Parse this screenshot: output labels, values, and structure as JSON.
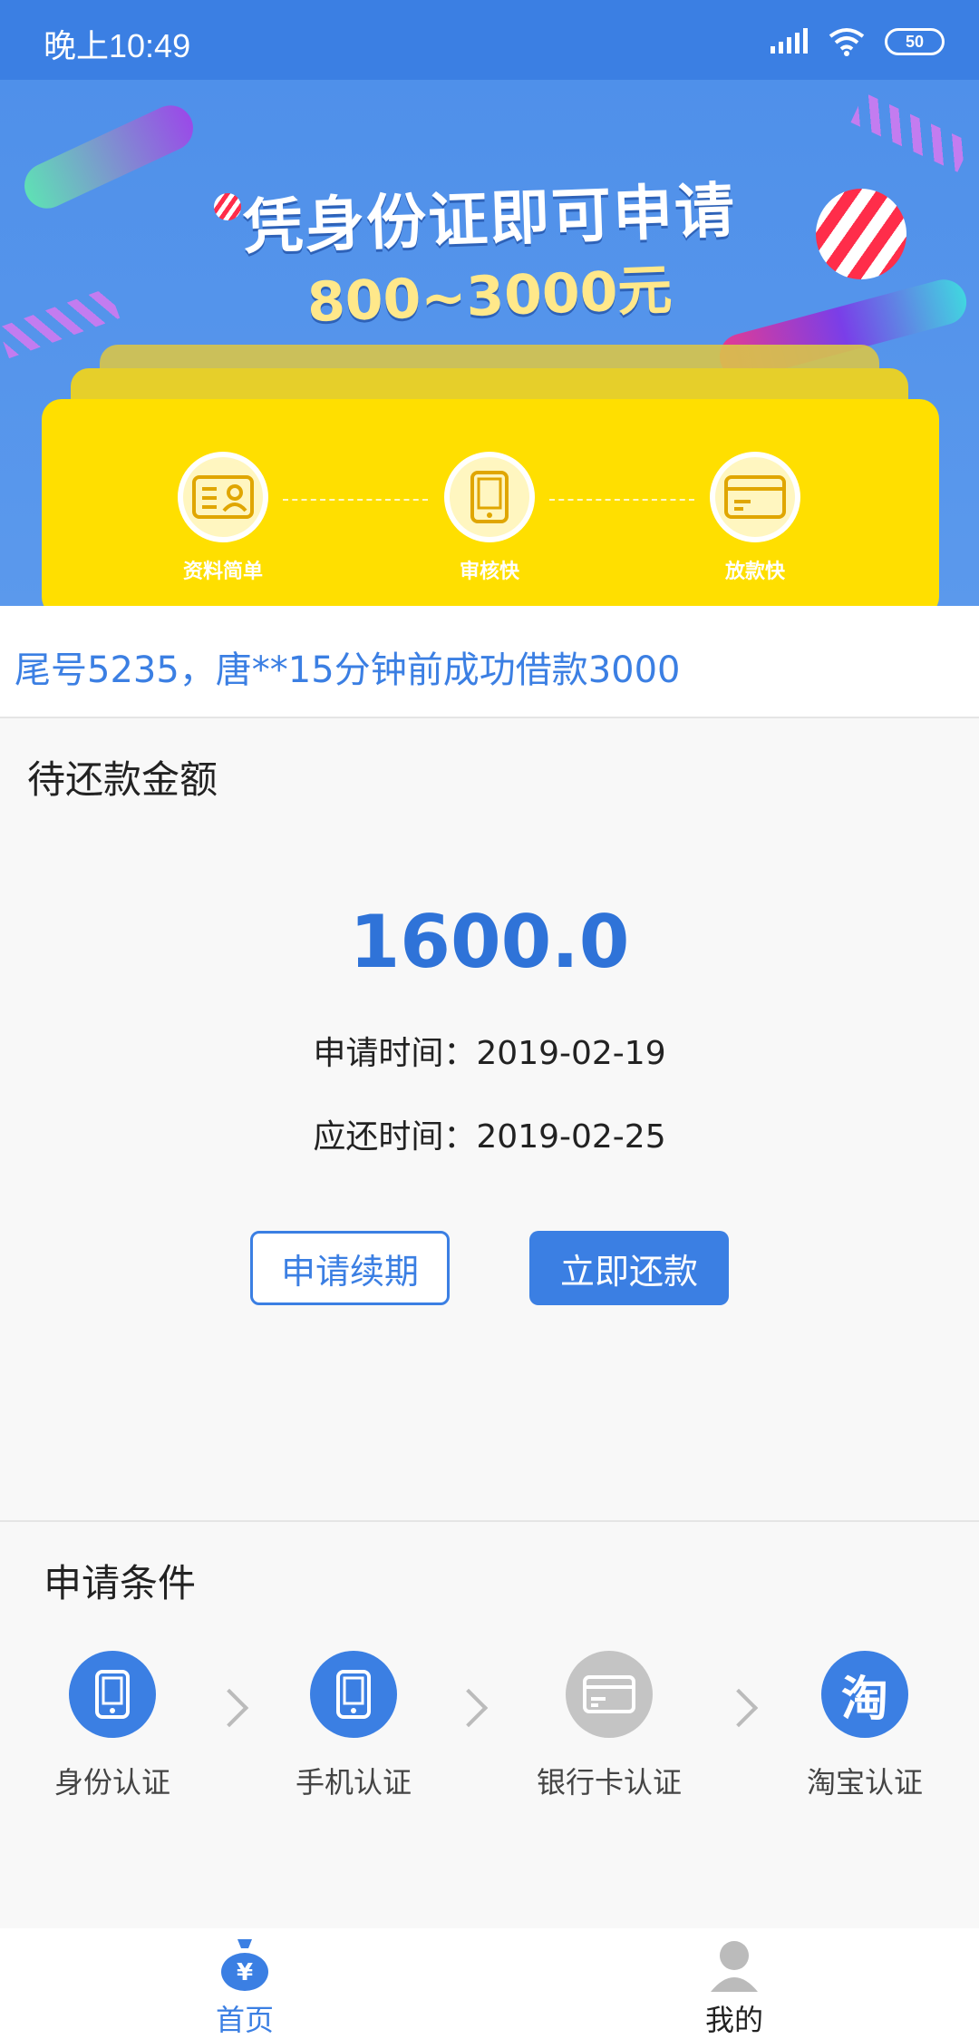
{
  "status_bar": {
    "time": "晚上10:49",
    "battery": "50"
  },
  "banner": {
    "headline": "凭身份证即可申请",
    "amount_range": "800~3000元",
    "steps": [
      {
        "label": "资料简单",
        "icon": "id-card-icon"
      },
      {
        "label": "审核快",
        "icon": "phone-icon"
      },
      {
        "label": "放款快",
        "icon": "bank-card-icon"
      }
    ]
  },
  "ticker": {
    "text": "尾号5235，唐**15分钟前成功借款3000"
  },
  "repayment": {
    "title": "待还款金额",
    "amount": "1600.0",
    "apply_date": "申请时间：2019-02-19",
    "due_date": "应还时间：2019-02-25",
    "renew_label": "申请续期",
    "repay_label": "立即还款"
  },
  "conditions": {
    "title": "申请条件",
    "items": [
      {
        "label": "身份认证",
        "icon": "phone-icon",
        "active": true
      },
      {
        "label": "手机认证",
        "icon": "phone-icon",
        "active": true
      },
      {
        "label": "银行卡认证",
        "icon": "bank-card-icon",
        "active": false
      },
      {
        "label": "淘宝认证",
        "icon": "taobao-icon",
        "active": true,
        "glyph": "淘"
      }
    ]
  },
  "nav": {
    "home": {
      "label": "首页",
      "icon": "money-bag-icon"
    },
    "mine": {
      "label": "我的",
      "icon": "user-icon"
    }
  },
  "colors": {
    "primary": "#3b7fe3",
    "banner_card": "#ffdf00",
    "inactive": "#c4c4c4"
  }
}
